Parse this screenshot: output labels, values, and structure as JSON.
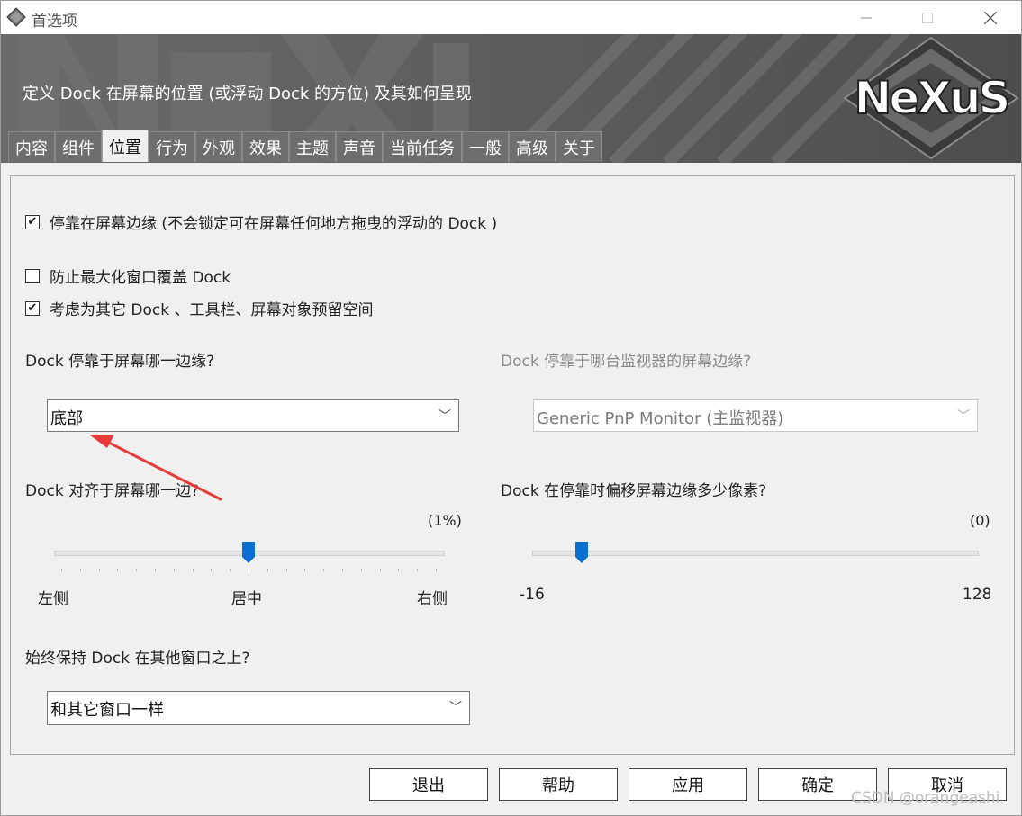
{
  "window": {
    "title": "首选项"
  },
  "banner": {
    "description": "定义 Dock 在屏幕的位置 (或浮动 Dock 的方位) 及其如何呈现",
    "logo_text": "NeXuS"
  },
  "tabs": [
    {
      "label": "内容"
    },
    {
      "label": "组件"
    },
    {
      "label": "位置",
      "active": true
    },
    {
      "label": "行为"
    },
    {
      "label": "外观"
    },
    {
      "label": "效果"
    },
    {
      "label": "主题"
    },
    {
      "label": "声音"
    },
    {
      "label": "当前任务"
    },
    {
      "label": "一般"
    },
    {
      "label": "高级"
    },
    {
      "label": "关于"
    }
  ],
  "options": {
    "dock_edge": {
      "checked": true,
      "label": "停靠在屏幕边缘 (不会锁定可在屏幕任何地方拖曳的浮动的 Dock )"
    },
    "prevent_cover": {
      "checked": false,
      "label": "防止最大化窗口覆盖 Dock"
    },
    "reserve_space": {
      "checked": true,
      "label": "考虑为其它 Dock 、工具栏、屏幕对象预留空间"
    }
  },
  "edge": {
    "question": "Dock 停靠于屏幕哪一边缘?",
    "value": "底部"
  },
  "monitor": {
    "question": "Dock 停靠于哪台监视器的屏幕边缘?",
    "value": "Generic PnP Monitor (主监视器)",
    "enabled": false
  },
  "align": {
    "question": "Dock 对齐于屏幕哪一边?",
    "readout": "(1%)",
    "position_fraction": 0.5,
    "labels": {
      "left": "左侧",
      "center": "居中",
      "right": "右侧"
    }
  },
  "offset": {
    "question": "Dock 在停靠时偏移屏幕边缘多少像素?",
    "readout": "(0)",
    "value": 0,
    "min": -16,
    "max": 128,
    "min_label": "-16",
    "max_label": "128"
  },
  "ontop": {
    "question": "始终保持 Dock 在其他窗口之上?",
    "value": "和其它窗口一样"
  },
  "buttons": {
    "exit": "退出",
    "help": "帮助",
    "apply": "应用",
    "ok": "确定",
    "cancel": "取消"
  },
  "watermark": "CSDN @orangeashi",
  "colors": {
    "accent": "#0a6fd0",
    "banner": "#5c5c5c",
    "annotation_arrow": "#e8393b"
  }
}
